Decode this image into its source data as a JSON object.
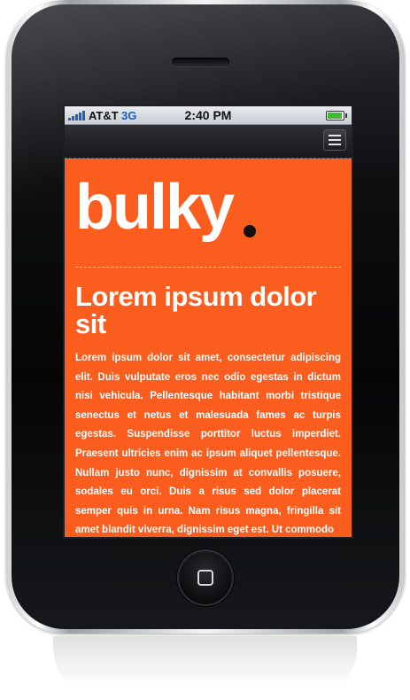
{
  "status_bar": {
    "carrier": "AT&T",
    "network": "3G",
    "time": "2:40 PM",
    "battery_level": 0.95,
    "signal_bars": 5
  },
  "nav": {
    "menu_icon": "hamburger-menu-icon"
  },
  "site": {
    "logo_text": "bulky",
    "accent_color": "#fb5d1f",
    "headline": "Lorem ipsum dolor sit",
    "body": "Lorem ipsum dolor sit amet, consectetur adipiscing elit. Duis vulputate eros nec odio egestas in dictum nisi vehicula. Pellentesque habitant morbi tristique senectus et netus et malesuada fames ac turpis egestas. Suspendisse porttitor luctus imperdiet. Praesent ultricies enim ac ipsum aliquet pellentesque. Nullam justo nunc, dignissim at convallis posuere, sodales eu orci. Duis a risus sed dolor placerat semper quis in urna. Nam risus magna, fringilla sit amet blandit viverra, dignissim eget est. Ut commodo"
  }
}
